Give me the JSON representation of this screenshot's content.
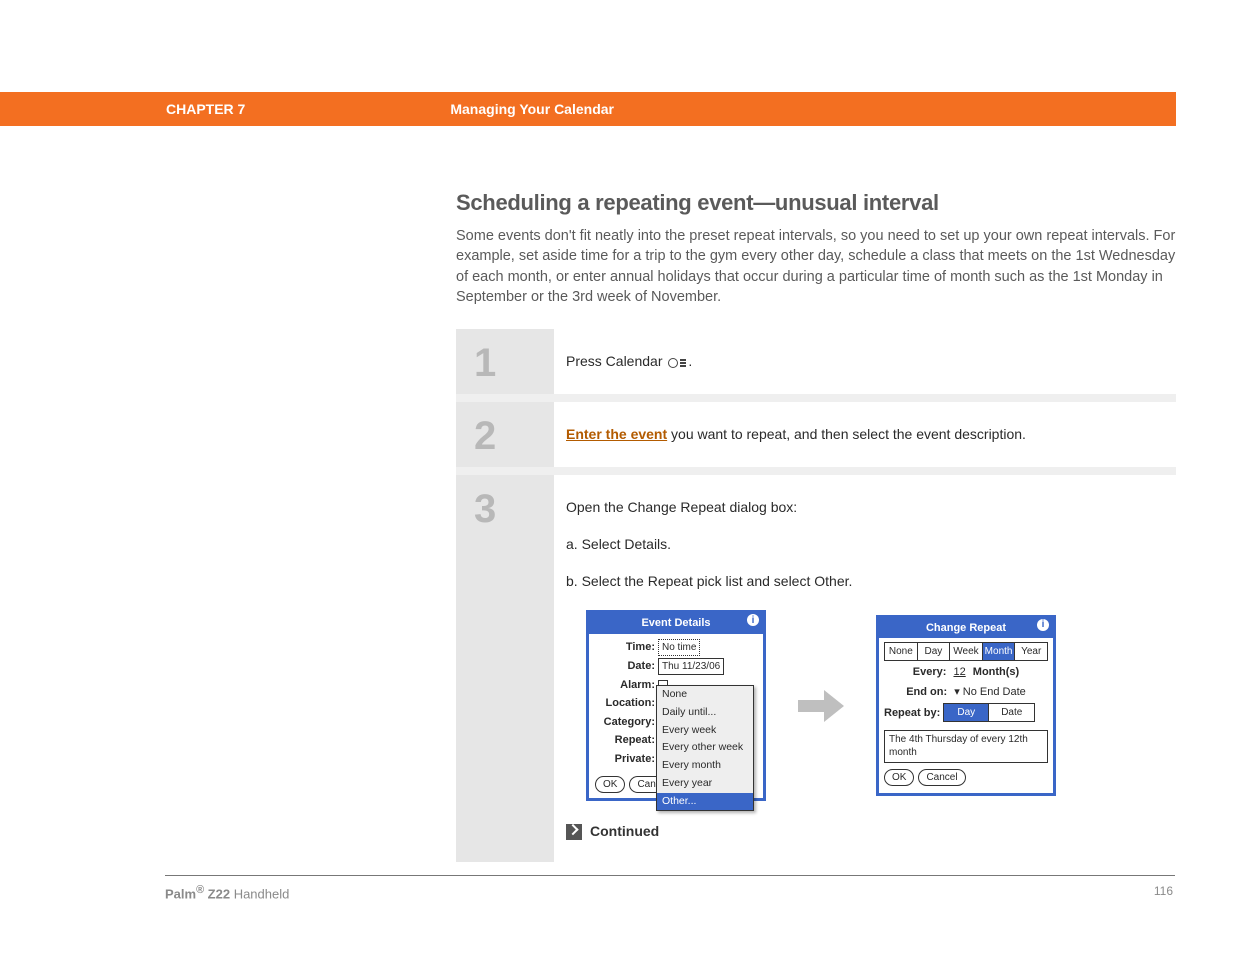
{
  "header": {
    "chapter": "CHAPTER 7",
    "title": "Managing Your Calendar"
  },
  "page": {
    "heading": "Scheduling a repeating event—unusual interval",
    "intro": "Some events don't fit neatly into the preset repeat intervals, so you need to set up your own repeat intervals. For example, set aside time for a trip to the gym every other day, schedule a class that meets on the 1st Wednesday of each month, or enter annual holidays that occur during a particular time of month such as the 1st Monday in September or the 3rd week of November."
  },
  "steps": {
    "s1": {
      "num": "1",
      "pre": "Press Calendar ",
      "post": "."
    },
    "s2": {
      "num": "2",
      "link": "Enter the event",
      "rest": " you want to repeat, and then select the event description."
    },
    "s3": {
      "num": "3",
      "intro": "Open the Change Repeat dialog box:",
      "a": "a.  Select Details.",
      "b": "b.  Select the Repeat pick list and select Other."
    }
  },
  "shot1": {
    "title": "Event Details",
    "time_lbl": "Time:",
    "time_val": "No time",
    "date_lbl": "Date:",
    "date_val": "Thu 11/23/06",
    "alarm_lbl": "Alarm:",
    "location_lbl": "Location:",
    "category_lbl": "Category:",
    "repeat_lbl": "Repeat:",
    "private_lbl": "Private:",
    "options": {
      "o1": "None",
      "o2": "Daily until...",
      "o3": "Every week",
      "o4": "Every other week",
      "o5": "Every month",
      "o6": "Every year",
      "o7": "Other..."
    },
    "ok": "OK",
    "cancel": "Can"
  },
  "shot2": {
    "title": "Change Repeat",
    "tabs": {
      "t1": "None",
      "t2": "Day",
      "t3": "Week",
      "t4": "Month",
      "t5": "Year"
    },
    "every_lbl": "Every:",
    "every_val": "12",
    "every_unit": "Month(s)",
    "end_lbl": "End on:",
    "end_val": "No End Date",
    "repeatby_lbl": "Repeat by:",
    "rb1": "Day",
    "rb2": "Date",
    "result": "The 4th Thursday of every 12th month",
    "ok": "OK",
    "cancel": "Cancel"
  },
  "continued": "Continued",
  "footer": {
    "brand": "Palm",
    "sup": "®",
    "model": " Z22",
    "rest": " Handheld",
    "page": "116"
  }
}
